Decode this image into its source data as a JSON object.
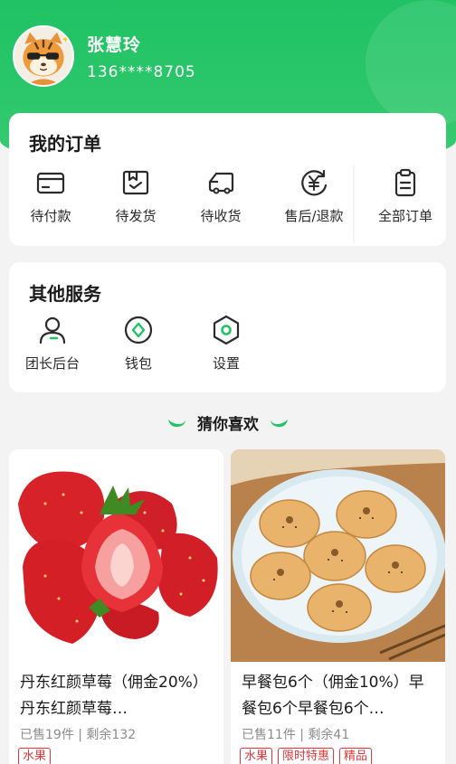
{
  "profile": {
    "name": "张慧玲",
    "phone": "136****8705"
  },
  "orders": {
    "title": "我的订单",
    "items": [
      {
        "label": "待付款",
        "icon": "wallet-icon"
      },
      {
        "label": "待发货",
        "icon": "package-icon"
      },
      {
        "label": "待收货",
        "icon": "truck-icon"
      },
      {
        "label": "售后/退款",
        "icon": "refund-icon"
      },
      {
        "label": "全部订单",
        "icon": "clipboard-icon"
      }
    ]
  },
  "services": {
    "title": "其他服务",
    "items": [
      {
        "label": "团长后台",
        "icon": "user-icon"
      },
      {
        "label": "钱包",
        "icon": "wallet-coin-icon"
      },
      {
        "label": "设置",
        "icon": "settings-hex-icon"
      }
    ]
  },
  "recommend": {
    "title": "猜你喜欢"
  },
  "products": [
    {
      "title": "丹东红颜草莓（佣金20%）丹东红颜草莓…",
      "sold": "已售19件 | 剩余132",
      "tags": [
        "水果"
      ],
      "image": "strawberries"
    },
    {
      "title": "早餐包6个（佣金10%）早餐包6个早餐包6个…",
      "sold": "已售11件 | 剩余41",
      "tags": [
        "水果",
        "限时特惠",
        "精品"
      ],
      "image": "buns"
    }
  ],
  "colors": {
    "brand_green": "#22c266",
    "icon_dark": "#2b2b2b",
    "tag_red": "#e0383a"
  }
}
